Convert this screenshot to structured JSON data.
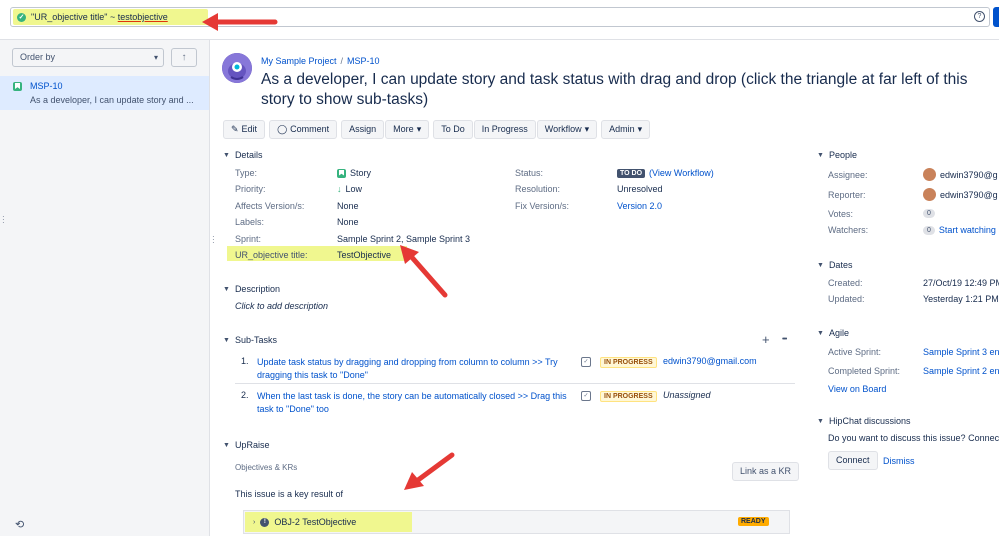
{
  "search": {
    "query_field": "\"UR_objective title\"",
    "query_op": "~",
    "query_value": "testobjective",
    "help_label": "?"
  },
  "left_panel": {
    "order_by_label": "Order by",
    "sort_icon": "arrow-up-icon",
    "result": {
      "key": "MSP-10",
      "summary": "As a developer, I can update story and ..."
    }
  },
  "issue": {
    "project": "My Sample Project",
    "key": "MSP-10",
    "title": "As a developer, I can update story and task status with drag and drop (click the triangle at far left of this story to show sub-tasks)"
  },
  "toolbar": {
    "edit": "Edit",
    "comment": "Comment",
    "assign": "Assign",
    "more": "More",
    "todo": "To Do",
    "in_progress": "In Progress",
    "workflow": "Workflow",
    "admin": "Admin"
  },
  "details": {
    "heading": "Details",
    "type_label": "Type:",
    "type_value": "Story",
    "priority_label": "Priority:",
    "priority_value": "Low",
    "affects_label": "Affects Version/s:",
    "affects_value": "None",
    "labels_label": "Labels:",
    "labels_value": "None",
    "sprint_label": "Sprint:",
    "sprint_value": "Sample Sprint 2, Sample Sprint 3",
    "ur_label": "UR_objective title:",
    "ur_value": "TestObjective",
    "status_label": "Status:",
    "status_badge": "TO DO",
    "status_link": "(View Workflow)",
    "resolution_label": "Resolution:",
    "resolution_value": "Unresolved",
    "fix_label": "Fix Version/s:",
    "fix_value": "Version 2.0"
  },
  "description": {
    "heading": "Description",
    "placeholder": "Click to add description"
  },
  "subtasks": {
    "heading": "Sub-Tasks",
    "add_icon": "+",
    "more_icon": "•••",
    "items": [
      {
        "num": "1.",
        "summary": "Update task status by dragging and dropping from column to column >> Try dragging this task to \"Done\"",
        "status": "IN PROGRESS",
        "assignee": "edwin3790@gmail.com"
      },
      {
        "num": "2.",
        "summary": "When the last task is done, the story can be automatically closed >> Drag this task to \"Done\" too",
        "status": "IN PROGRESS",
        "assignee": "Unassigned"
      }
    ]
  },
  "upraise": {
    "heading": "UpRaise",
    "subheading": "Objectives & KRs",
    "link_button": "Link as a KR",
    "text": "This issue is a key result of",
    "okr_label": "OBJ-2 TestObjective",
    "okr_status": "READY"
  },
  "people": {
    "heading": "People",
    "assignee_label": "Assignee:",
    "assignee_value": "edwin3790@g",
    "reporter_label": "Reporter:",
    "reporter_value": "edwin3790@g",
    "votes_label": "Votes:",
    "votes_count": "0",
    "watchers_label": "Watchers:",
    "watchers_count": "0",
    "watchers_link": "Start watching"
  },
  "dates": {
    "heading": "Dates",
    "created_label": "Created:",
    "created_value": "27/Oct/19 12:49 PM",
    "updated_label": "Updated:",
    "updated_value": "Yesterday 1:21 PM"
  },
  "agile": {
    "heading": "Agile",
    "active_label": "Active Sprint:",
    "active_value": "Sample Sprint 3 en",
    "completed_label": "Completed Sprint:",
    "completed_value": "Sample Sprint 2 en",
    "board_link": "View on Board"
  },
  "hipchat": {
    "heading": "HipChat discussions",
    "question": "Do you want to discuss this issue? Connec",
    "connect": "Connect",
    "dismiss": "Dismiss"
  },
  "colors": {
    "highlight": "#f0f78f",
    "arrow": "#e53935",
    "link": "#0052cc"
  }
}
